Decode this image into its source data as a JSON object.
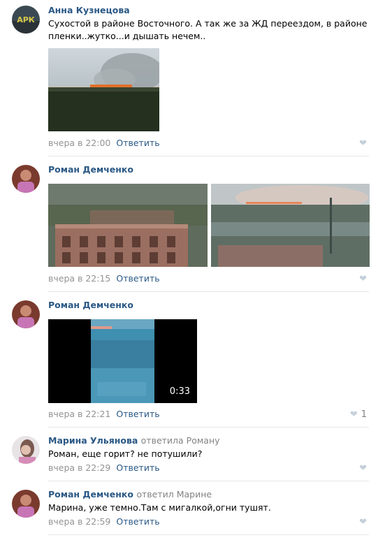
{
  "comments": [
    {
      "author": "Анна Кузнецова",
      "reply_to": "",
      "text": "Сухостой в районе Восточного. А так же за ЖД переездом, в районе пленки..жутко...и дышать нечем..",
      "time": "вчера в 22:00",
      "reply_label": "Ответить",
      "likes": ""
    },
    {
      "author": "Роман Демченко",
      "reply_to": "",
      "text": "",
      "time": "вчера в 22:15",
      "reply_label": "Ответить",
      "likes": ""
    },
    {
      "author": "Роман Демченко",
      "reply_to": "",
      "text": "",
      "time": "вчера в 22:21",
      "reply_label": "Ответить",
      "likes": "1",
      "video_duration": "0:33"
    },
    {
      "author": "Марина Ульянова",
      "reply_to": "ответила Роману",
      "text": "Роман, еще горит? не потушили?",
      "time": "вчера в 22:29",
      "reply_label": "Ответить",
      "likes": ""
    },
    {
      "author": "Роман Демченко",
      "reply_to": "ответил Марине",
      "text": "Марина, уже темно.Там с мигалкой,огни тушят.",
      "time": "вчера в 22:59",
      "reply_label": "Ответить",
      "likes": ""
    }
  ],
  "avatars": {
    "anna_text": "АРК"
  },
  "colors": {
    "link": "#2a5885",
    "meta": "#939393",
    "separator": "#e7e8ec",
    "like_icon": "#c5d0db"
  },
  "icons": {
    "like": "heart-icon"
  }
}
